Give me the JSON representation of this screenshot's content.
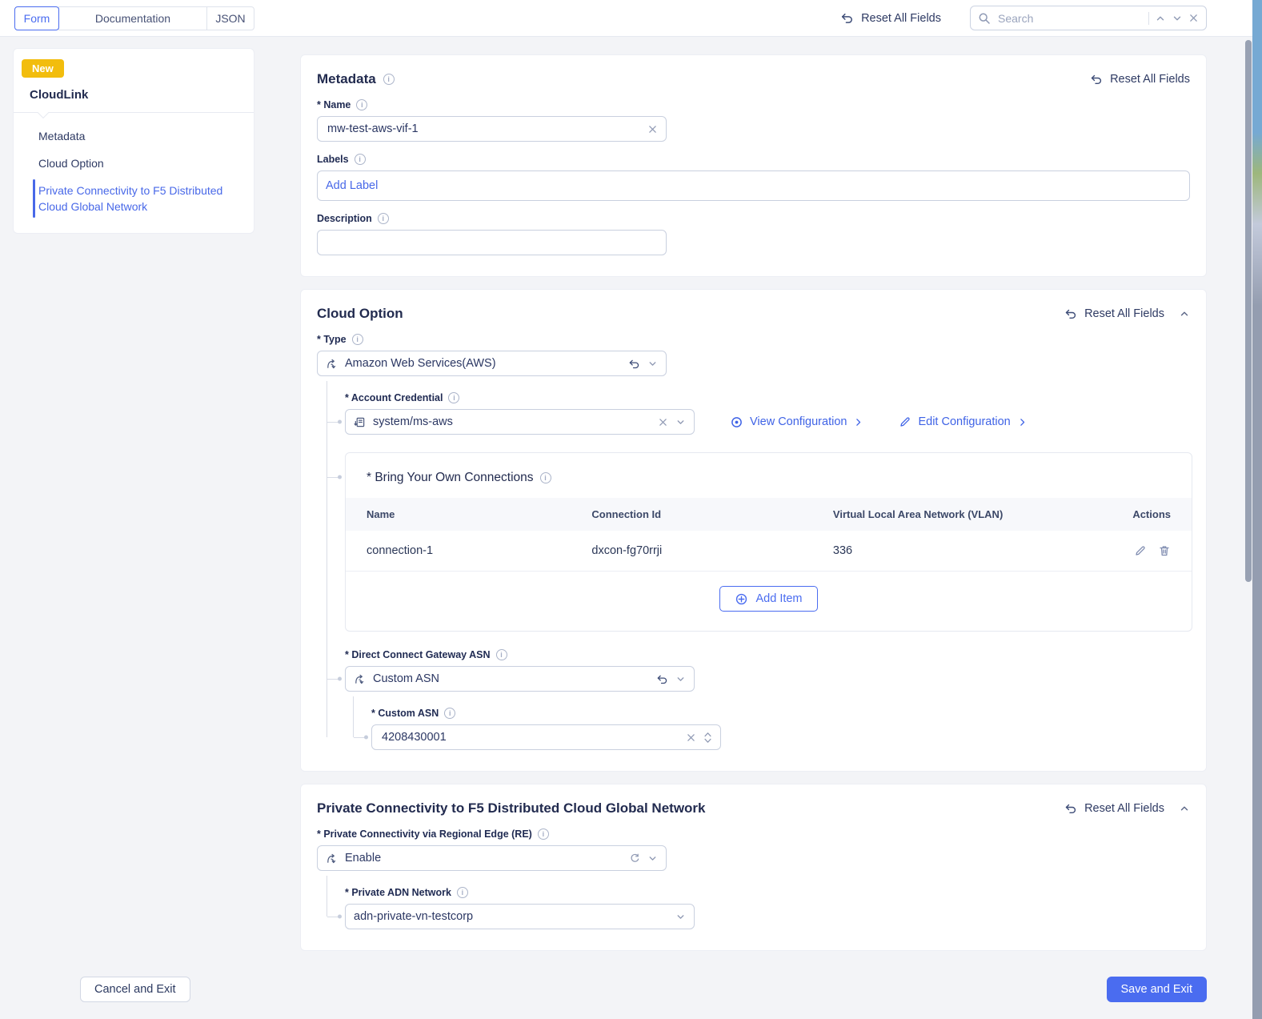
{
  "colors": {
    "accent_blue": "#4A6CF0",
    "link_blue": "#3F63E6",
    "badge_yellow": "#F2BD0D",
    "heading_navy": "#222B4F",
    "page_bg": "#F3F4F7"
  },
  "header": {
    "tabs": [
      {
        "label": "Form",
        "active": true
      },
      {
        "label": "Documentation",
        "active": false
      },
      {
        "label": "JSON",
        "active": false
      }
    ],
    "reset_all_label": "Reset All Fields",
    "search": {
      "placeholder": "Search"
    },
    "icons": [
      "undo-icon",
      "search-icon",
      "chevron-up-icon",
      "chevron-down-icon",
      "close-icon"
    ]
  },
  "sidebar": {
    "badge": "New",
    "title": "CloudLink",
    "items": [
      {
        "label": "Metadata",
        "active": false
      },
      {
        "label": "Cloud Option",
        "active": false
      },
      {
        "label": "Private Connectivity to F5 Distributed Cloud Global Network",
        "active": true
      }
    ]
  },
  "metadata_section": {
    "title": "Metadata",
    "reset_label": "Reset All Fields",
    "name_label": "* Name",
    "name_value": "mw-test-aws-vif-1",
    "labels_label": "Labels",
    "labels_placeholder": "Add Label",
    "description_label": "Description",
    "description_value": ""
  },
  "cloud_option_section": {
    "title": "Cloud Option",
    "reset_label": "Reset All Fields",
    "type_label": "* Type",
    "type_value": "Amazon Web Services(AWS)",
    "account_credential_label": "* Account Credential",
    "account_credential_value": "system/ms-aws",
    "view_configuration_label": "View Configuration",
    "edit_configuration_label": "Edit Configuration",
    "byoc": {
      "title": "* Bring Your Own Connections",
      "columns": [
        "Name",
        "Connection Id",
        "Virtual Local Area Network (VLAN)",
        "Actions"
      ],
      "rows": [
        {
          "name": "connection-1",
          "connection_id": "dxcon-fg70rrji",
          "vlan": "336"
        }
      ],
      "add_item_label": "Add Item"
    },
    "dcg_asn_label": "* Direct Connect Gateway ASN",
    "dcg_asn_value": "Custom ASN",
    "custom_asn_label": "* Custom ASN",
    "custom_asn_value": "4208430001"
  },
  "private_connectivity_section": {
    "title": "Private Connectivity to F5 Distributed Cloud Global Network",
    "reset_label": "Reset All Fields",
    "re_label": "* Private Connectivity via Regional Edge (RE)",
    "re_value": "Enable",
    "adn_label": "* Private ADN Network",
    "adn_value": "adn-private-vn-testcorp"
  },
  "footer": {
    "cancel_label": "Cancel and Exit",
    "save_label": "Save and Exit"
  }
}
